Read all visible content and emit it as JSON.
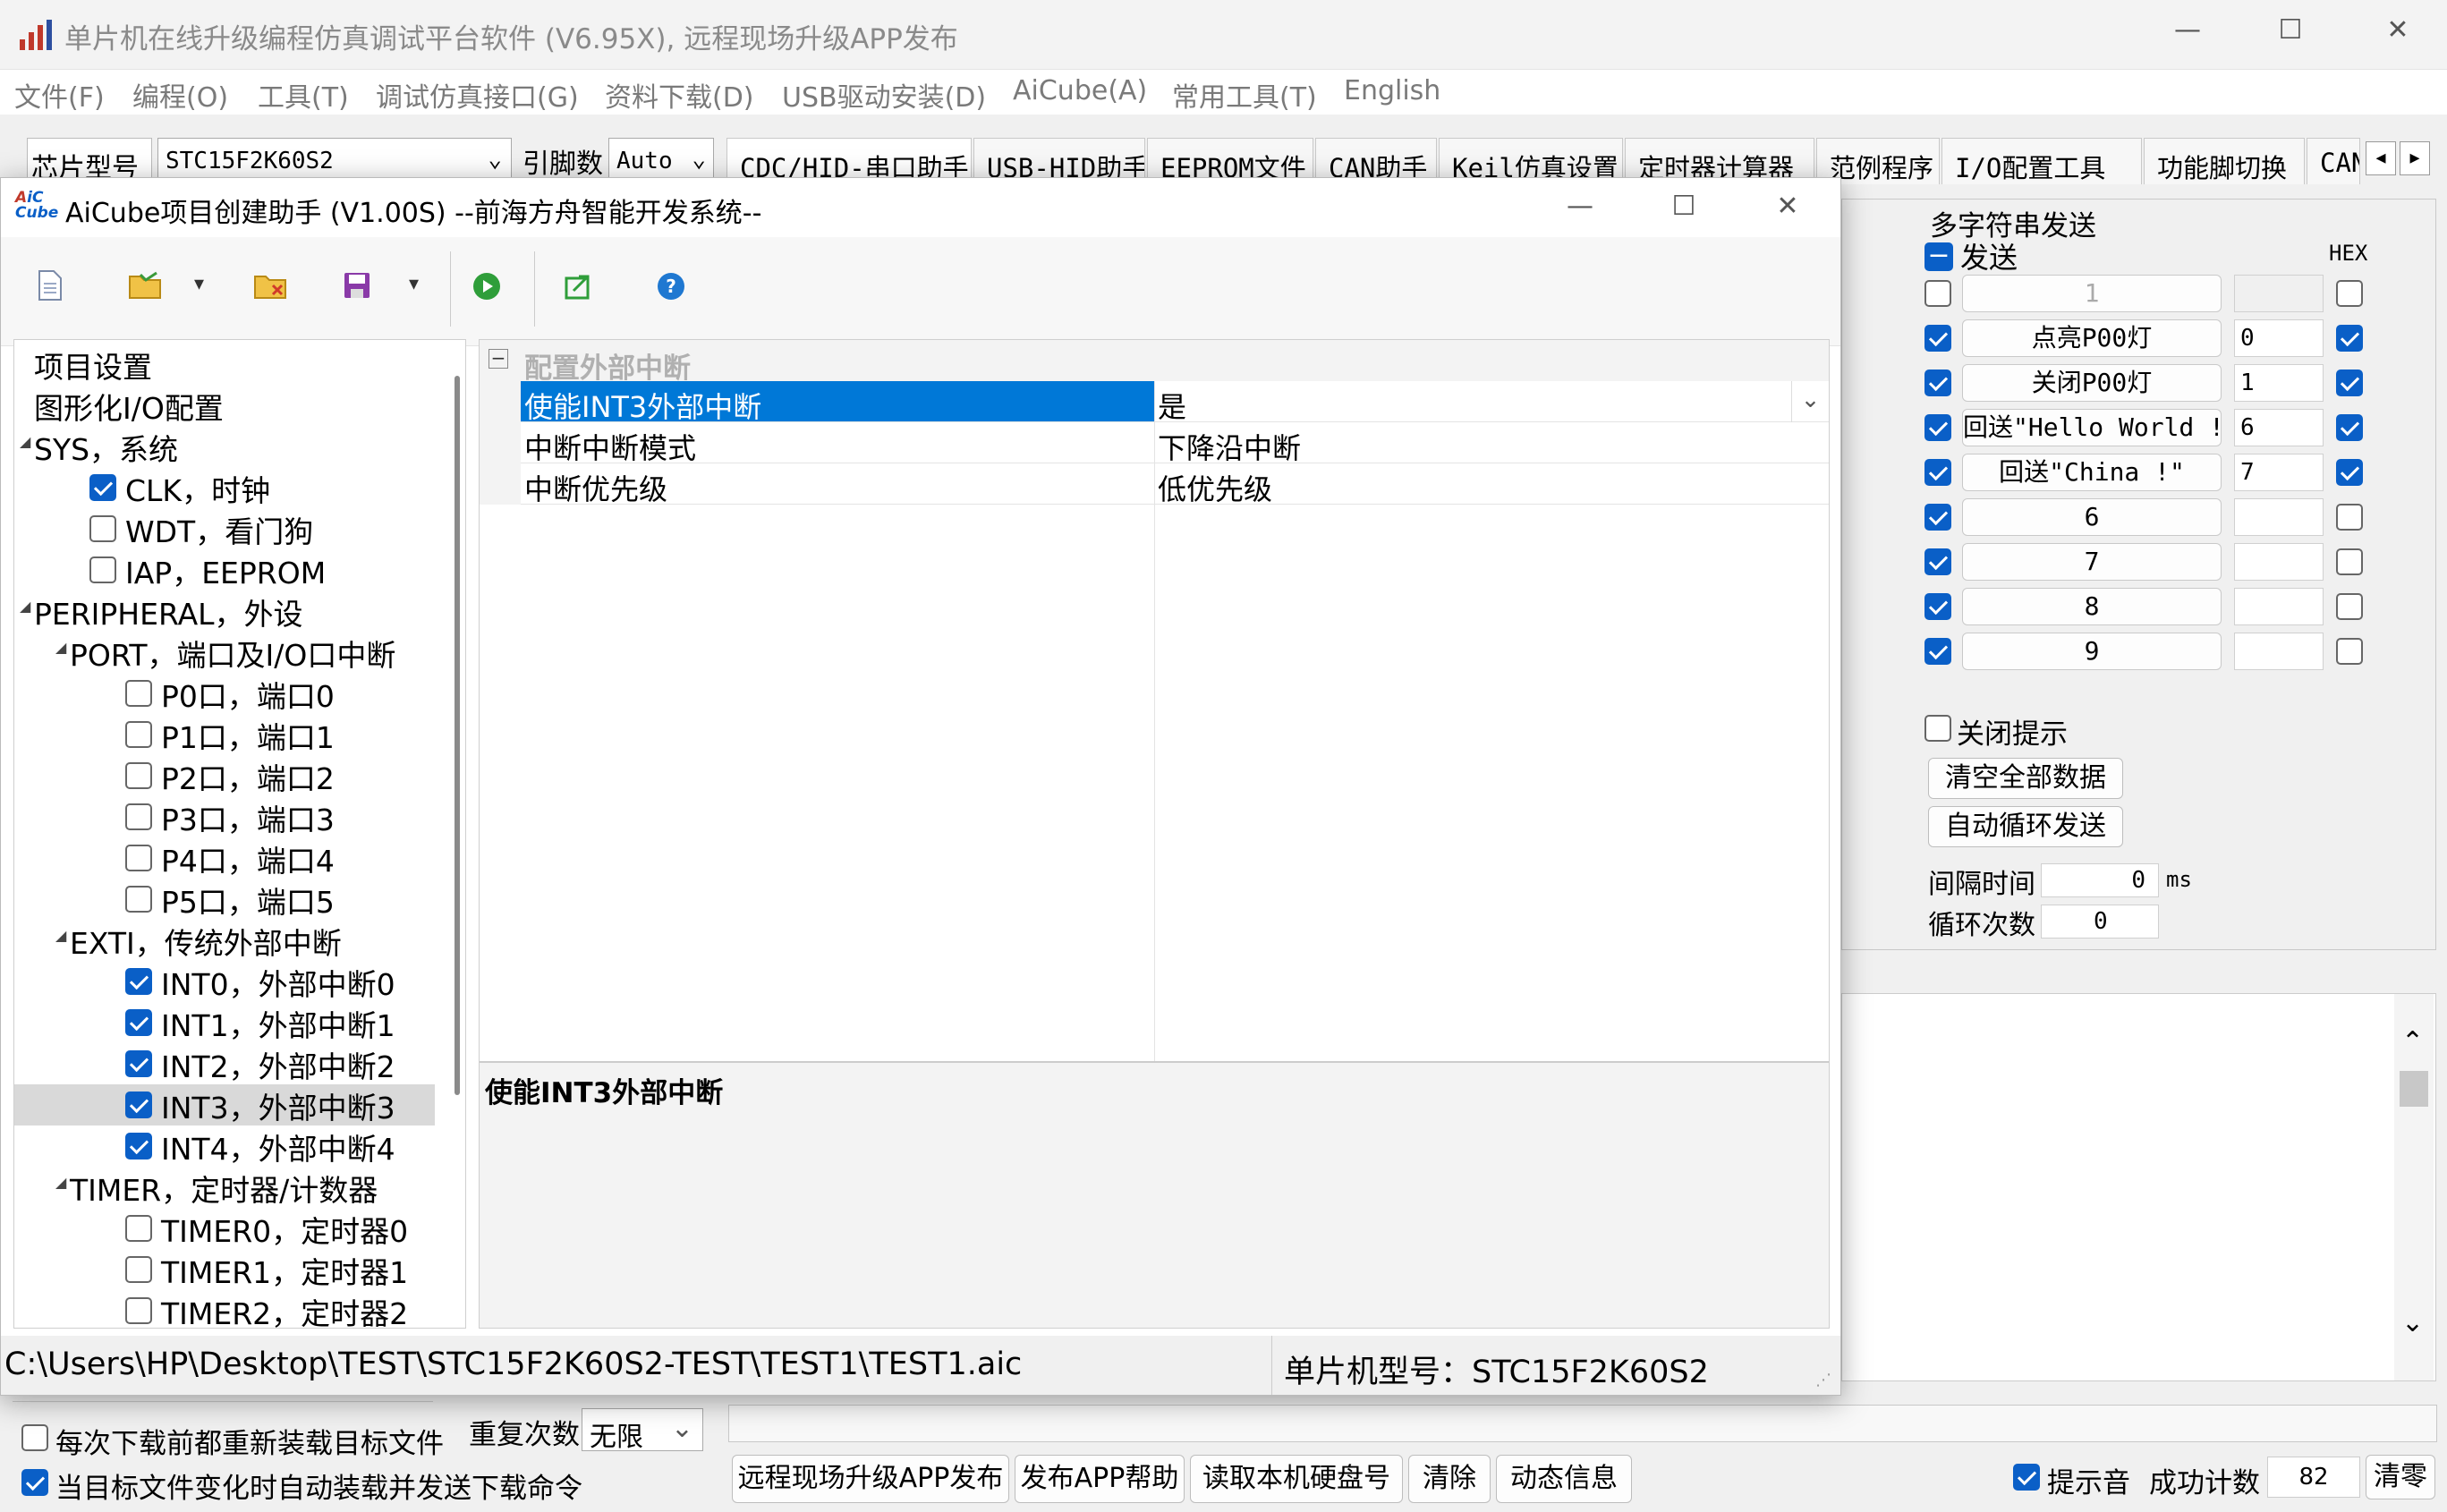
{
  "main_window": {
    "title": "单片机在线升级编程仿真调试平台软件 (V6.95X), 远程现场升级APP发布",
    "menu": [
      "文件(F)",
      "编程(O)",
      "工具(T)",
      "调试仿真接口(G)",
      "资料下载(D)",
      "USB驱动安装(D)",
      "AiCube(A)",
      "常用工具(T)",
      "English"
    ],
    "chip_label": "芯片型号",
    "chip_value": "STC15F2K60S2",
    "pin_label": "引脚数",
    "pin_value": "Auto",
    "tabs": [
      "CDC/HID-串口助手",
      "USB-HID助手",
      "EEPROM文件",
      "CAN助手",
      "Keil仿真设置",
      "定时器计算器",
      "范例程序",
      "I/O配置工具",
      "功能脚切换",
      "CAN"
    ]
  },
  "multi_send": {
    "title": "多字符串发送",
    "send_label": "发送",
    "hex_label": "HEX",
    "rows": [
      {
        "checked": false,
        "label": "1",
        "value": "",
        "hex": false
      },
      {
        "checked": true,
        "label": "点亮P00灯",
        "value": "0",
        "hex": true
      },
      {
        "checked": true,
        "label": "关闭P00灯",
        "value": "1",
        "hex": true
      },
      {
        "checked": true,
        "label": "回送\"Hello World !\"",
        "value": "6",
        "hex": true
      },
      {
        "checked": true,
        "label": "回送\"China !\"",
        "value": "7",
        "hex": true
      },
      {
        "checked": true,
        "label": "6",
        "value": "",
        "hex": false
      },
      {
        "checked": true,
        "label": "7",
        "value": "",
        "hex": false
      },
      {
        "checked": true,
        "label": "8",
        "value": "",
        "hex": false
      },
      {
        "checked": true,
        "label": "9",
        "value": "",
        "hex": false
      }
    ],
    "close_tip_label": "关闭提示",
    "clear_all_label": "清空全部数据",
    "auto_loop_label": "自动循环发送",
    "interval_label": "间隔时间",
    "interval_value": "0",
    "interval_unit": "ms",
    "loop_label": "循环次数",
    "loop_value": "0"
  },
  "bottom": {
    "reload_label": "每次下载前都重新装载目标文件",
    "auto_reload_label": "当目标文件变化时自动装载并发送下载命令",
    "repeat_label": "重复次数",
    "repeat_value": "无限",
    "buttons": [
      "远程现场升级APP发布",
      "发布APP帮助",
      "读取本机硬盘号",
      "清除",
      "动态信息"
    ],
    "beep_label": "提示音",
    "success_label": "成功计数",
    "success_value": "82",
    "clear_label": "清零"
  },
  "dialog": {
    "title": "AiCube项目创建助手 (V1.00S) --前海方舟智能开发系统--",
    "tree": [
      {
        "label": "项目设置",
        "level": 0,
        "exp": false,
        "chk": null
      },
      {
        "label": "图形化I/O配置",
        "level": 0,
        "exp": false,
        "chk": null
      },
      {
        "label": "SYS，系统",
        "level": 0,
        "exp": true,
        "chk": null
      },
      {
        "label": "CLK，时钟",
        "level": 1,
        "exp": false,
        "chk": true
      },
      {
        "label": "WDT，看门狗",
        "level": 1,
        "exp": false,
        "chk": false
      },
      {
        "label": "IAP，EEPROM",
        "level": 1,
        "exp": false,
        "chk": false
      },
      {
        "label": "PERIPHERAL，外设",
        "level": 0,
        "exp": true,
        "chk": null
      },
      {
        "label": "PORT，端口及I/O口中断",
        "level": 1,
        "exp": true,
        "chk": null
      },
      {
        "label": "P0口，端口0",
        "level": 2,
        "exp": false,
        "chk": false
      },
      {
        "label": "P1口，端口1",
        "level": 2,
        "exp": false,
        "chk": false
      },
      {
        "label": "P2口，端口2",
        "level": 2,
        "exp": false,
        "chk": false
      },
      {
        "label": "P3口，端口3",
        "level": 2,
        "exp": false,
        "chk": false
      },
      {
        "label": "P4口，端口4",
        "level": 2,
        "exp": false,
        "chk": false
      },
      {
        "label": "P5口，端口5",
        "level": 2,
        "exp": false,
        "chk": false
      },
      {
        "label": "EXTI，传统外部中断",
        "level": 1,
        "exp": true,
        "chk": null
      },
      {
        "label": "INT0，外部中断0",
        "level": 2,
        "exp": false,
        "chk": true
      },
      {
        "label": "INT1，外部中断1",
        "level": 2,
        "exp": false,
        "chk": true
      },
      {
        "label": "INT2，外部中断2",
        "level": 2,
        "exp": false,
        "chk": true
      },
      {
        "label": "INT3，外部中断3",
        "level": 2,
        "exp": false,
        "chk": true,
        "selected": true
      },
      {
        "label": "INT4，外部中断4",
        "level": 2,
        "exp": false,
        "chk": true
      },
      {
        "label": "TIMER，定时器/计数器",
        "level": 1,
        "exp": true,
        "chk": null
      },
      {
        "label": "TIMER0，定时器0",
        "level": 2,
        "exp": false,
        "chk": false
      },
      {
        "label": "TIMER1，定时器1",
        "level": 2,
        "exp": false,
        "chk": false
      },
      {
        "label": "TIMER2，定时器2",
        "level": 2,
        "exp": false,
        "chk": false
      }
    ],
    "group_label": "配置外部中断",
    "properties": [
      {
        "name": "使能INT3外部中断",
        "value": "是"
      },
      {
        "name": "中断中断模式",
        "value": "下降沿中断"
      },
      {
        "name": "中断优先级",
        "value": "低优先级"
      }
    ],
    "description": "使能INT3外部中断",
    "status_path": "C:\\Users\\HP\\Desktop\\TEST\\STC15F2K60S2-TEST\\TEST1\\TEST1.aic",
    "status_chip": "单片机型号：STC15F2K60S2"
  },
  "colors": {
    "accent": "#0a5fc7",
    "selection": "#0078d7"
  }
}
